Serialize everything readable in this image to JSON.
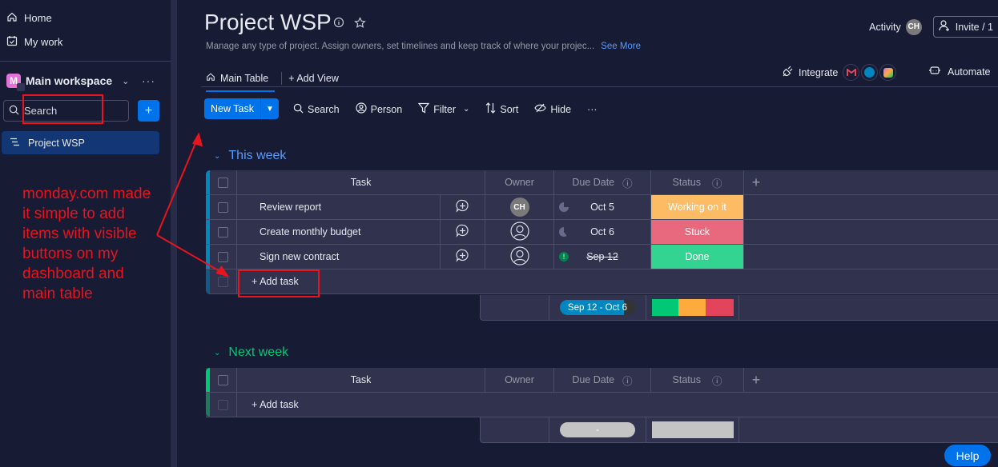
{
  "sidebar": {
    "nav": [
      {
        "label": "Home",
        "icon": "home-icon"
      },
      {
        "label": "My work",
        "icon": "calendar-check-icon"
      }
    ],
    "workspace": {
      "avatar_letter": "M",
      "name": "Main workspace"
    },
    "search_label": "Search",
    "add_button": "+",
    "boards": [
      {
        "label": "Project WSP",
        "active": true
      }
    ]
  },
  "annotation": {
    "text": "monday.com made it simple to add items with visible buttons on my dashboard and main table",
    "color": "#e8141e"
  },
  "header": {
    "title": "Project WSP",
    "description": "Manage any type of project. Assign owners, set timelines and keep track of where your projec...",
    "see_more": "See More",
    "tabs": [
      {
        "label": "Main Table",
        "active": true
      },
      {
        "label": "+ Add View"
      }
    ],
    "activity_label": "Activity",
    "activity_avatar": "CH",
    "invite_label": "Invite / 1",
    "integrate_label": "Integrate",
    "automate_label": "Automate"
  },
  "toolbar": {
    "new_task": "New Task",
    "search": "Search",
    "person": "Person",
    "filter": "Filter",
    "sort": "Sort",
    "hide": "Hide",
    "more": "···"
  },
  "columns": {
    "task": "Task",
    "owner": "Owner",
    "due": "Due Date",
    "status": "Status",
    "add": "+"
  },
  "groups": [
    {
      "title": "This week",
      "color": "#579bfc",
      "bar_color": "#0086c0",
      "items": [
        {
          "name": "Review report",
          "owner": "CH",
          "due": "Oct 5",
          "due_state": "progress",
          "status": "Working on it",
          "status_color": "#fdbc64"
        },
        {
          "name": "Create monthly budget",
          "owner": "",
          "due": "Oct 6",
          "due_state": "progress",
          "status": "Stuck",
          "status_color": "#e8697d"
        },
        {
          "name": "Sign new contract",
          "owner": "",
          "due": "Sep 12",
          "due_state": "overdue-done",
          "status": "Done",
          "status_color": "#33d391"
        }
      ],
      "add_task": "+ Add task",
      "summary": {
        "date_range": "Sep 12 - Oct 6",
        "date_progress": 0.85,
        "status_distribution": [
          {
            "label": "Done",
            "fraction": 0.333,
            "color": "#00c875"
          },
          {
            "label": "Working on it",
            "fraction": 0.333,
            "color": "#fdab3d"
          },
          {
            "label": "Stuck",
            "fraction": 0.334,
            "color": "#e2445c"
          }
        ]
      }
    },
    {
      "title": "Next week",
      "color": "#00c875",
      "bar_color": "#00c875",
      "items": [],
      "add_task": "+ Add task",
      "summary": {
        "date_range": "-",
        "status_distribution": []
      }
    }
  ],
  "help_label": "Help"
}
